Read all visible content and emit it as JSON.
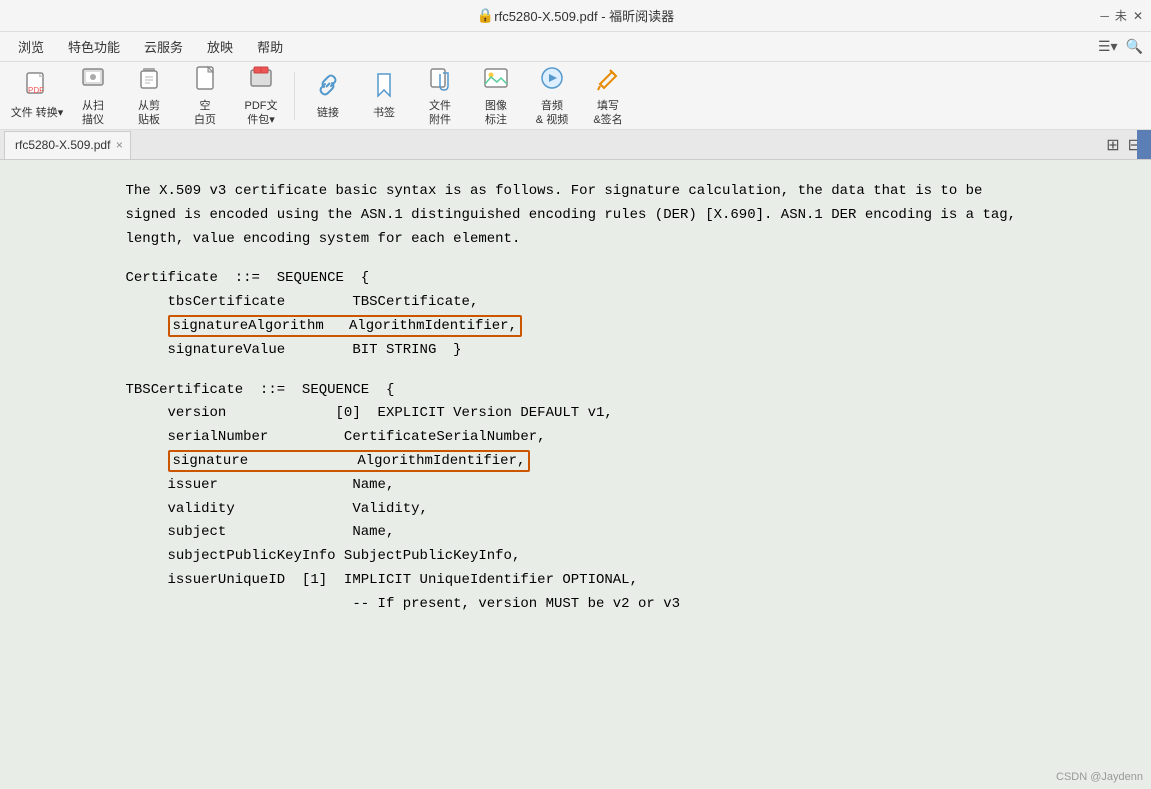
{
  "titlebar": {
    "title": "rfc5280-X.509.pdf - 福昕阅读器",
    "icon": "🔒",
    "unmaximize": "未"
  },
  "menubar": {
    "items": [
      "浏览",
      "特色功能",
      "云服务",
      "放映",
      "帮助"
    ],
    "right_icons": [
      "≡▾",
      "🔍"
    ]
  },
  "toolbar": {
    "buttons": [
      {
        "icon": "📄",
        "label": "文件\n转换▾"
      },
      {
        "icon": "📷",
        "label": "从扫\n描仪"
      },
      {
        "icon": "📋",
        "label": "从剪\n贴板"
      },
      {
        "icon": "⬜",
        "label": "空\n白页"
      },
      {
        "icon": "📦",
        "label": "PDF文\n件包▾"
      },
      {
        "icon": "🔗",
        "label": "链接"
      },
      {
        "icon": "🔖",
        "label": "书签"
      },
      {
        "icon": "📎",
        "label": "文件\n附件"
      },
      {
        "icon": "🖼",
        "label": "图像\n标注"
      },
      {
        "icon": "🎵",
        "label": "音频\n& 视频"
      },
      {
        "icon": "✏️",
        "label": "填写\n&签名"
      }
    ]
  },
  "tab": {
    "label": "rfc5280-X.509.pdf",
    "close": "×"
  },
  "tab_bar_icons": [
    "⊞",
    "⊟"
  ],
  "content": {
    "paragraph": "The X.509 v3 certificate basic syntax is as follows.  For signature calculation, the data that is to be signed is encoded using the ASN.1 distinguished encoding rules (DER) [X.690].  ASN.1 DER encoding is a tag, length, value encoding system for each element.",
    "certificate_label": "Certificate  ::=  SEQUENCE  {",
    "cert_lines": [
      {
        "indent": "     ",
        "key": "tbsCertificate",
        "spaces": "       ",
        "value": "TBSCertificate,",
        "highlight": false
      },
      {
        "indent": "     ",
        "key": "signatureAlgorithm",
        "spaces": "   ",
        "value": "AlgorithmIdentifier,",
        "highlight": true
      },
      {
        "indent": "     ",
        "key": "signatureValue",
        "spaces": "       ",
        "value": "BIT STRING  }",
        "highlight": false
      }
    ],
    "tbs_label": "TBSCertificate  ::=  SEQUENCE  {",
    "tbs_lines": [
      {
        "indent": "     ",
        "key": "version",
        "spaces": "            ",
        "value": "[0]  EXPLICIT Version DEFAULT v1,",
        "highlight": false
      },
      {
        "indent": "     ",
        "key": "serialNumber",
        "spaces": "          ",
        "value": "CertificateSerialNumber,",
        "highlight": false
      },
      {
        "indent": "     ",
        "key": "signature",
        "spaces": "             ",
        "value": "AlgorithmIdentifier,",
        "highlight": true
      },
      {
        "indent": "     ",
        "key": "issuer",
        "spaces": "               ",
        "value": "Name,",
        "highlight": false
      },
      {
        "indent": "     ",
        "key": "validity",
        "spaces": "              ",
        "value": "Validity,",
        "highlight": false
      },
      {
        "indent": "     ",
        "key": "subject",
        "spaces": "              ",
        "value": "Name,",
        "highlight": false
      },
      {
        "indent": "     ",
        "key": "subjectPublicKeyInfo",
        "spaces": " ",
        "value": "SubjectPublicKeyInfo,",
        "highlight": false
      },
      {
        "indent": "     ",
        "key": "issuerUniqueID",
        "spaces": "  [1]  ",
        "value": "IMPLICIT UniqueIdentifier OPTIONAL,",
        "highlight": false
      },
      {
        "indent": "          ",
        "key": "",
        "spaces": "    ",
        "value": "-- If present, version MUST be v2 or v3",
        "highlight": false
      }
    ]
  },
  "watermark": "CSDN @Jaydenn"
}
